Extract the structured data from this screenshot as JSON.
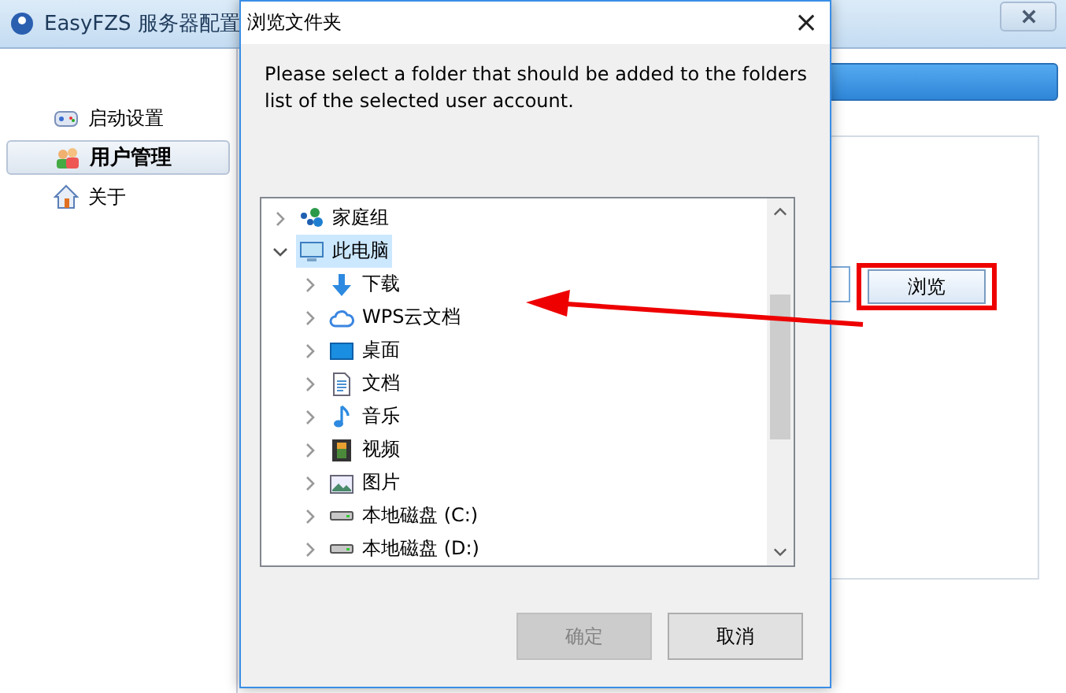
{
  "app_window": {
    "title": "EasyFZS 服务器配置",
    "sidebar": {
      "items": [
        {
          "label": "启动设置",
          "kind": "gear",
          "selected": false
        },
        {
          "label": "用户管理",
          "kind": "users",
          "selected": true
        },
        {
          "label": "关于",
          "kind": "house",
          "selected": false
        }
      ]
    },
    "browse_button": "浏览"
  },
  "dialog": {
    "title": "浏览文件夹",
    "close": "×",
    "message": "Please select a folder that should be added to the folders list of the selected user account.",
    "tree": [
      {
        "label": "家庭组",
        "kind": "homegroup",
        "expanded": false,
        "selected": false
      },
      {
        "label": "此电脑",
        "kind": "computer",
        "expanded": true,
        "selected": true,
        "children": [
          {
            "label": "下载",
            "kind": "download",
            "expanded": false,
            "selected": false
          },
          {
            "label": "WPS云文档",
            "kind": "cloud",
            "expanded": false,
            "selected": false
          },
          {
            "label": "桌面",
            "kind": "desktop",
            "expanded": false,
            "selected": false
          },
          {
            "label": "文档",
            "kind": "document",
            "expanded": false,
            "selected": false
          },
          {
            "label": "音乐",
            "kind": "music",
            "expanded": false,
            "selected": false
          },
          {
            "label": "视频",
            "kind": "film",
            "expanded": false,
            "selected": false
          },
          {
            "label": "图片",
            "kind": "image",
            "expanded": false,
            "selected": false
          },
          {
            "label": "本地磁盘 (C:)",
            "kind": "drive",
            "expanded": false,
            "selected": false
          },
          {
            "label": "本地磁盘 (D:)",
            "kind": "drive",
            "expanded": false,
            "selected": false
          }
        ]
      }
    ],
    "buttons": [
      {
        "label": "确定",
        "disabled": true
      },
      {
        "label": "取消",
        "disabled": false
      }
    ]
  }
}
